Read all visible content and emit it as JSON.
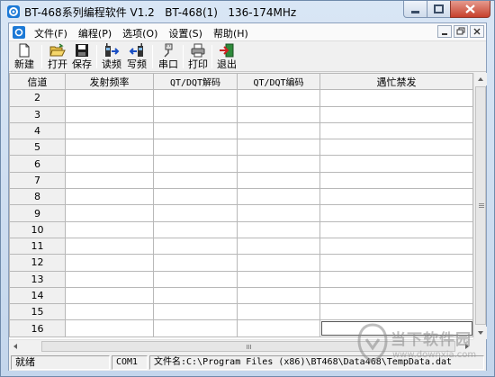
{
  "window": {
    "title": "BT-468系列编程软件 V1.2   BT-468(1)   136-174MHz"
  },
  "menu": {
    "items": [
      {
        "label": "文件(F)"
      },
      {
        "label": "编程(P)"
      },
      {
        "label": "选项(O)"
      },
      {
        "label": "设置(S)"
      },
      {
        "label": "帮助(H)"
      }
    ]
  },
  "toolbar": {
    "buttons": [
      {
        "label": "新建",
        "icon": "new-file-icon"
      },
      {
        "label": "打开",
        "icon": "open-folder-icon"
      },
      {
        "label": "保存",
        "icon": "save-disk-icon"
      },
      {
        "label": "读频",
        "icon": "read-radio-icon"
      },
      {
        "label": "写频",
        "icon": "write-radio-icon"
      },
      {
        "label": "串口",
        "icon": "serial-port-icon"
      },
      {
        "label": "打印",
        "icon": "printer-icon"
      },
      {
        "label": "退出",
        "icon": "exit-icon"
      }
    ]
  },
  "grid": {
    "columns": [
      "信道",
      "发射频率",
      "QT/DQT解码",
      "QT/DQT编码",
      "遇忙禁发"
    ],
    "rows": [
      "2",
      "3",
      "4",
      "5",
      "6",
      "7",
      "8",
      "9",
      "10",
      "11",
      "12",
      "13",
      "14",
      "15",
      "16"
    ]
  },
  "statusbar": {
    "status": "就绪",
    "port": "COM1",
    "file": "文件名:C:\\Program Files (x86)\\BT468\\Data468\\TempData.dat"
  },
  "watermark": {
    "text": "当下软件园",
    "url": "www.downxia.com"
  },
  "colors": {
    "titlebar": "#d0dff0",
    "grid_line": "#b8b8b8",
    "close_button": "#c7402c"
  }
}
